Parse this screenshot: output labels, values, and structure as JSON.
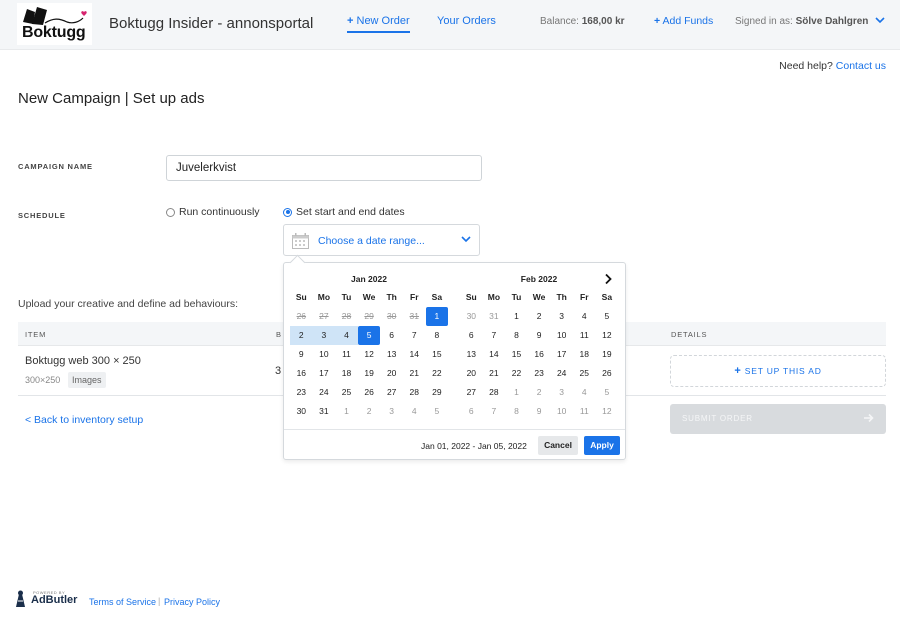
{
  "header": {
    "logo_text": "Boktugg",
    "app_title": "Boktugg Insider - annonsportal",
    "nav_new_order": "New Order",
    "nav_your_orders": "Your Orders",
    "balance_label": "Balance:",
    "balance_value": "168,00 kr",
    "add_funds": "Add Funds",
    "signed_in_label": "Signed in as:",
    "signed_in_user": "Sölve Dahlgren"
  },
  "help": {
    "text": "Need help?",
    "link": "Contact us"
  },
  "page_title": "New Campaign | Set up ads",
  "form": {
    "campaign_name_label": "CAMPAIGN NAME",
    "campaign_name_value": "Juvelerkvist",
    "schedule_label": "SCHEDULE",
    "run_continuously": "Run continuously",
    "set_dates": "Set start and end dates",
    "date_placeholder": "Choose a date range..."
  },
  "upload_text": "Upload your creative and define ad behaviours:",
  "table": {
    "headers": [
      "ITEM",
      "B",
      "DETAILS"
    ],
    "row": {
      "name": "Boktugg web 300 × 250",
      "size": "300×250",
      "tag": "Images",
      "partial": "3",
      "setup": "SET UP THIS AD"
    }
  },
  "back_link": "< Back to inventory setup",
  "submit": "SUBMIT ORDER",
  "picker": {
    "weekdays": [
      "Su",
      "Mo",
      "Tu",
      "We",
      "Th",
      "Fr",
      "Sa"
    ],
    "months": [
      {
        "title": "Jan 2022",
        "days": [
          {
            "d": "26",
            "s": "strike"
          },
          {
            "d": "27",
            "s": "strike"
          },
          {
            "d": "28",
            "s": "strike"
          },
          {
            "d": "29",
            "s": "strike"
          },
          {
            "d": "30",
            "s": "strike"
          },
          {
            "d": "31",
            "s": "strike"
          },
          {
            "d": "1",
            "s": "sel"
          },
          {
            "d": "2",
            "s": "range"
          },
          {
            "d": "3",
            "s": "range"
          },
          {
            "d": "4",
            "s": "range"
          },
          {
            "d": "5",
            "s": "sel"
          },
          {
            "d": "6",
            "s": ""
          },
          {
            "d": "7",
            "s": ""
          },
          {
            "d": "8",
            "s": ""
          },
          {
            "d": "9",
            "s": ""
          },
          {
            "d": "10",
            "s": ""
          },
          {
            "d": "11",
            "s": ""
          },
          {
            "d": "12",
            "s": ""
          },
          {
            "d": "13",
            "s": ""
          },
          {
            "d": "14",
            "s": ""
          },
          {
            "d": "15",
            "s": ""
          },
          {
            "d": "16",
            "s": ""
          },
          {
            "d": "17",
            "s": ""
          },
          {
            "d": "18",
            "s": ""
          },
          {
            "d": "19",
            "s": ""
          },
          {
            "d": "20",
            "s": ""
          },
          {
            "d": "21",
            "s": ""
          },
          {
            "d": "22",
            "s": ""
          },
          {
            "d": "23",
            "s": ""
          },
          {
            "d": "24",
            "s": ""
          },
          {
            "d": "25",
            "s": ""
          },
          {
            "d": "26",
            "s": ""
          },
          {
            "d": "27",
            "s": ""
          },
          {
            "d": "28",
            "s": ""
          },
          {
            "d": "29",
            "s": ""
          },
          {
            "d": "30",
            "s": ""
          },
          {
            "d": "31",
            "s": ""
          },
          {
            "d": "1",
            "s": "off"
          },
          {
            "d": "2",
            "s": "off"
          },
          {
            "d": "3",
            "s": "off"
          },
          {
            "d": "4",
            "s": "off"
          },
          {
            "d": "5",
            "s": "off"
          }
        ]
      },
      {
        "title": "Feb 2022",
        "days": [
          {
            "d": "30",
            "s": "off"
          },
          {
            "d": "31",
            "s": "off"
          },
          {
            "d": "1",
            "s": ""
          },
          {
            "d": "2",
            "s": ""
          },
          {
            "d": "3",
            "s": ""
          },
          {
            "d": "4",
            "s": ""
          },
          {
            "d": "5",
            "s": ""
          },
          {
            "d": "6",
            "s": ""
          },
          {
            "d": "7",
            "s": ""
          },
          {
            "d": "8",
            "s": ""
          },
          {
            "d": "9",
            "s": ""
          },
          {
            "d": "10",
            "s": ""
          },
          {
            "d": "11",
            "s": ""
          },
          {
            "d": "12",
            "s": ""
          },
          {
            "d": "13",
            "s": ""
          },
          {
            "d": "14",
            "s": ""
          },
          {
            "d": "15",
            "s": ""
          },
          {
            "d": "16",
            "s": ""
          },
          {
            "d": "17",
            "s": ""
          },
          {
            "d": "18",
            "s": ""
          },
          {
            "d": "19",
            "s": ""
          },
          {
            "d": "20",
            "s": ""
          },
          {
            "d": "21",
            "s": ""
          },
          {
            "d": "22",
            "s": ""
          },
          {
            "d": "23",
            "s": ""
          },
          {
            "d": "24",
            "s": ""
          },
          {
            "d": "25",
            "s": ""
          },
          {
            "d": "26",
            "s": ""
          },
          {
            "d": "27",
            "s": ""
          },
          {
            "d": "28",
            "s": ""
          },
          {
            "d": "1",
            "s": "off"
          },
          {
            "d": "2",
            "s": "off"
          },
          {
            "d": "3",
            "s": "off"
          },
          {
            "d": "4",
            "s": "off"
          },
          {
            "d": "5",
            "s": "off"
          },
          {
            "d": "6",
            "s": "off"
          },
          {
            "d": "7",
            "s": "off"
          },
          {
            "d": "8",
            "s": "off"
          },
          {
            "d": "9",
            "s": "off"
          },
          {
            "d": "10",
            "s": "off"
          },
          {
            "d": "11",
            "s": "off"
          },
          {
            "d": "12",
            "s": "off"
          }
        ]
      }
    ],
    "range_text": "Jan 01, 2022 - Jan 05, 2022",
    "cancel": "Cancel",
    "apply": "Apply"
  },
  "footer": {
    "powered_by": "POWERED BY",
    "adbutler": "AdButler",
    "terms": "Terms of Service",
    "separator": "|",
    "privacy": "Privacy Policy"
  },
  "colors": {
    "accent": "#1a73e8",
    "range": "#cfe4f7",
    "header_bg": "#f4f6f8"
  }
}
